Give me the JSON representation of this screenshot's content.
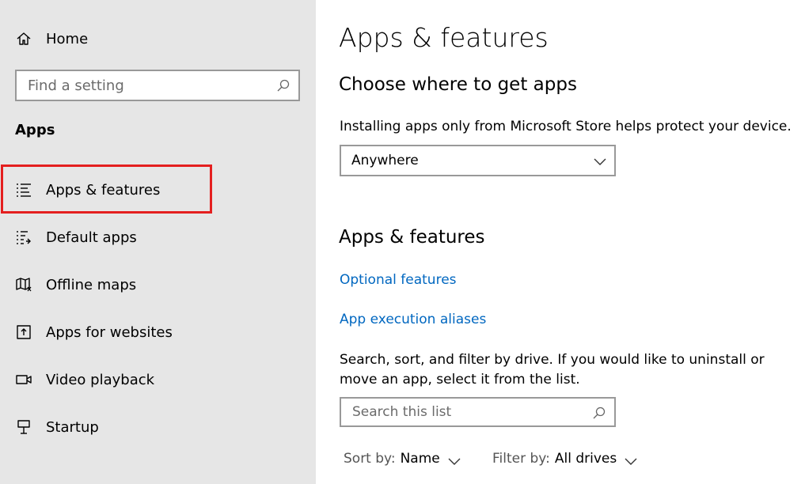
{
  "sidebar": {
    "home_label": "Home",
    "search_placeholder": "Find a setting",
    "section_heading": "Apps",
    "items": [
      {
        "label": "Apps & features",
        "icon": "apps-features-icon"
      },
      {
        "label": "Default apps",
        "icon": "default-apps-icon"
      },
      {
        "label": "Offline maps",
        "icon": "offline-maps-icon"
      },
      {
        "label": "Apps for websites",
        "icon": "apps-websites-icon"
      },
      {
        "label": "Video playback",
        "icon": "video-playback-icon"
      },
      {
        "label": "Startup",
        "icon": "startup-icon"
      }
    ],
    "selected_index": 0
  },
  "main": {
    "page_title": "Apps & features",
    "choose_heading": "Choose where to get apps",
    "choose_description": "Installing apps only from Microsoft Store helps protect your device.",
    "source_dropdown_value": "Anywhere",
    "apps_heading": "Apps & features",
    "link_optional_features": "Optional features",
    "link_app_aliases": "App execution aliases",
    "list_description": "Search, sort, and filter by drive. If you would like to uninstall or move an app, select it from the list.",
    "list_search_placeholder": "Search this list",
    "sort_label": "Sort by:",
    "sort_value": "Name",
    "filter_label": "Filter by:",
    "filter_value": "All drives"
  },
  "colors": {
    "sidebar_bg": "#e6e6e6",
    "link": "#0067c0",
    "highlight_border": "#e41f1f",
    "input_border": "#999999"
  }
}
